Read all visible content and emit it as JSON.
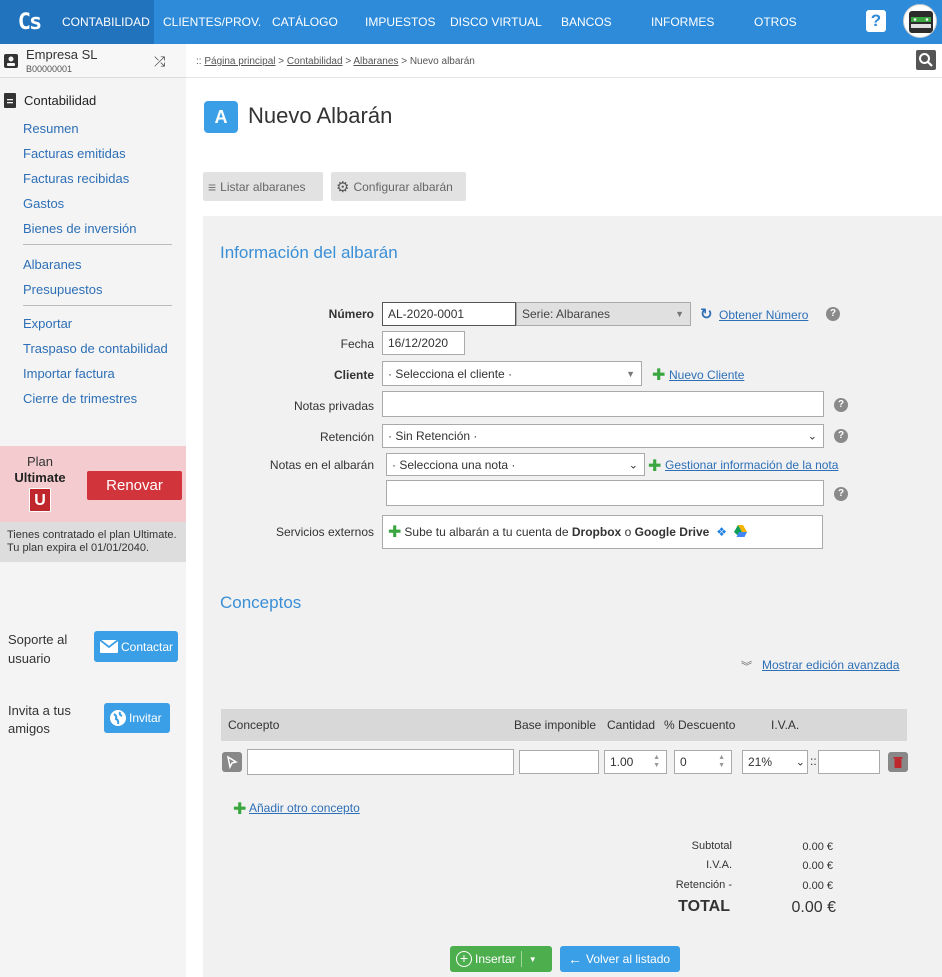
{
  "nav": {
    "logo": "Cs",
    "items": [
      "CONTABILIDAD",
      "CLIENTES/PROV.",
      "CATÁLOGO",
      "IMPUESTOS",
      "DISCO VIRTUAL",
      "BANCOS",
      "INFORMES",
      "OTROS"
    ],
    "help": "?"
  },
  "company": {
    "name": "Empresa SL",
    "code": "B00000001"
  },
  "breadcrumb": {
    "prefix": "::",
    "home": "Página principal",
    "sep": ">",
    "section": "Contabilidad",
    "list": "Albaranes",
    "current": "Nuevo albarán"
  },
  "sidebar": {
    "heading": "Contabilidad",
    "group1": [
      "Resumen",
      "Facturas emitidas",
      "Facturas recibidas",
      "Gastos",
      "Bienes de inversión"
    ],
    "group2": [
      "Albaranes",
      "Presupuestos"
    ],
    "group3": [
      "Exportar",
      "Traspaso de contabilidad",
      "Importar factura",
      "Cierre de trimestres"
    ],
    "plan_label": "Plan",
    "plan_name": "Ultimate",
    "plan_badge": "U",
    "renew": "Renovar",
    "plan_note_1": "Tienes contratado el plan Ultimate.",
    "plan_note_2": "Tu plan expira el 01/01/2040.",
    "support_1": "Soporte al",
    "support_2": "usuario",
    "contact": "Contactar",
    "invite_1": "Invita a tus",
    "invite_2": "amigos",
    "invite": "Invitar"
  },
  "page": {
    "title_icon": "A",
    "title": "Nuevo Albarán",
    "list_btn": "Listar albaranes",
    "config_btn": "Configurar albarán"
  },
  "form": {
    "section": "Información del albarán",
    "numero_label": "Número",
    "numero_value": "AL-2020-0001",
    "serie": "Serie: Albaranes",
    "obtener": "Obtener Número",
    "fecha_label": "Fecha",
    "fecha_value": "16/12/2020",
    "cliente_label": "Cliente",
    "cliente_value": "· Selecciona el cliente ·",
    "nuevo_cliente": "Nuevo Cliente",
    "notas_privadas_label": "Notas privadas",
    "retencion_label": "Retención",
    "retencion_value": "· Sin Retención ·",
    "notas_albaran_label": "Notas en el albarán",
    "nota_value": "· Selecciona una nota ·",
    "gestionar": "Gestionar información de la nota",
    "servicios_label": "Servicios externos",
    "servicios_pre": "Sube tu albarán a tu cuenta de",
    "dropbox": "Dropbox",
    "o": "o",
    "gdrive": "Google Drive",
    "help": "?"
  },
  "conceptos": {
    "section": "Conceptos",
    "advanced": "Mostrar edición avanzada",
    "headers": {
      "concepto": "Concepto",
      "base": "Base imponible",
      "cantidad": "Cantidad",
      "descuento": "% Descuento",
      "iva": "I.V.A."
    },
    "row": {
      "cantidad": "1.00",
      "descuento": "0",
      "iva": "21%",
      "sep": "::"
    },
    "add": "Añadir otro concepto"
  },
  "totals": {
    "subtotal_label": "Subtotal",
    "subtotal": "0.00 €",
    "iva_label": "I.V.A.",
    "iva": "0.00 €",
    "ret_label": "Retención -",
    "ret": "0.00 €",
    "total_label": "TOTAL",
    "total": "0.00 €"
  },
  "actions": {
    "insert": "Insertar",
    "back": "Volver al listado"
  },
  "colors": {
    "topbar": "#2d8bd9",
    "accent": "#3a9fe6",
    "renew": "#d1343a",
    "add": "#3aa640",
    "insert": "#4cae4c"
  }
}
